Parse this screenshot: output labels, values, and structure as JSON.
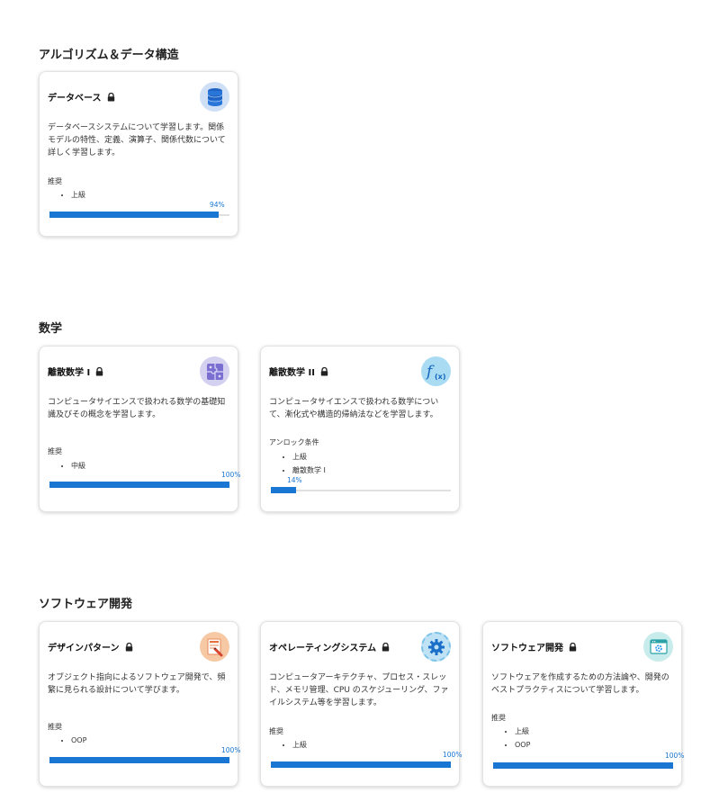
{
  "sections": [
    {
      "title": "アルゴリズム＆データ構造",
      "cards": [
        {
          "title": "データベース",
          "icon": "database-icon",
          "description": "データベースシステムについて学習します。関係モデルの特性、定義、演算子、関係代数について詳しく学習します。",
          "requirement_label": "推奨",
          "requirements": [
            "上級"
          ],
          "progress": 94,
          "progress_label": "94%"
        }
      ]
    },
    {
      "title": "数学",
      "cards": [
        {
          "title": "離散数学 I",
          "icon": "puzzle-icon",
          "description": "コンピュータサイエンスで扱われる数学の基礎知識及びその概念を学習します。",
          "requirement_label": "推奨",
          "requirements": [
            "中級"
          ],
          "progress": 100,
          "progress_label": "100%"
        },
        {
          "title": "離散数学 II",
          "icon": "function-icon",
          "description": "コンピュータサイエンスで扱われる数学について、漸化式や構造的帰納法などを学習します。",
          "requirement_label": "アンロック条件",
          "requirements": [
            "上級",
            "離散数学 I"
          ],
          "progress": 14,
          "progress_label": "14%"
        }
      ]
    },
    {
      "title": "ソフトウェア開発",
      "cards": [
        {
          "title": "デザインパターン",
          "icon": "design-pencil-icon",
          "description": "オブジェクト指向によるソフトウェア開発で、頻繁に見られる設計について学びます。",
          "requirement_label": "推奨",
          "requirements": [
            "OOP"
          ],
          "progress": 100,
          "progress_label": "100%"
        },
        {
          "title": "オペレーティングシステム",
          "icon": "gear-icon",
          "description": "コンピュータアーキテクチャ、プロセス・スレッド、メモリ管理、CPU のスケジューリング、ファイルシステム等を学習します。",
          "requirement_label": "推奨",
          "requirements": [
            "上級"
          ],
          "progress": 100,
          "progress_label": "100%"
        },
        {
          "title": "ソフトウェア開発",
          "icon": "browser-gear-icon",
          "description": "ソフトウェアを作成するための方法論や、開発のベストプラクティスについて学習します。",
          "requirement_label": "推奨",
          "requirements": [
            "上級",
            "OOP"
          ],
          "progress": 100,
          "progress_label": "100%"
        }
      ]
    }
  ],
  "colors": {
    "accent": "#1976d2",
    "track": "#e0e0e0"
  }
}
